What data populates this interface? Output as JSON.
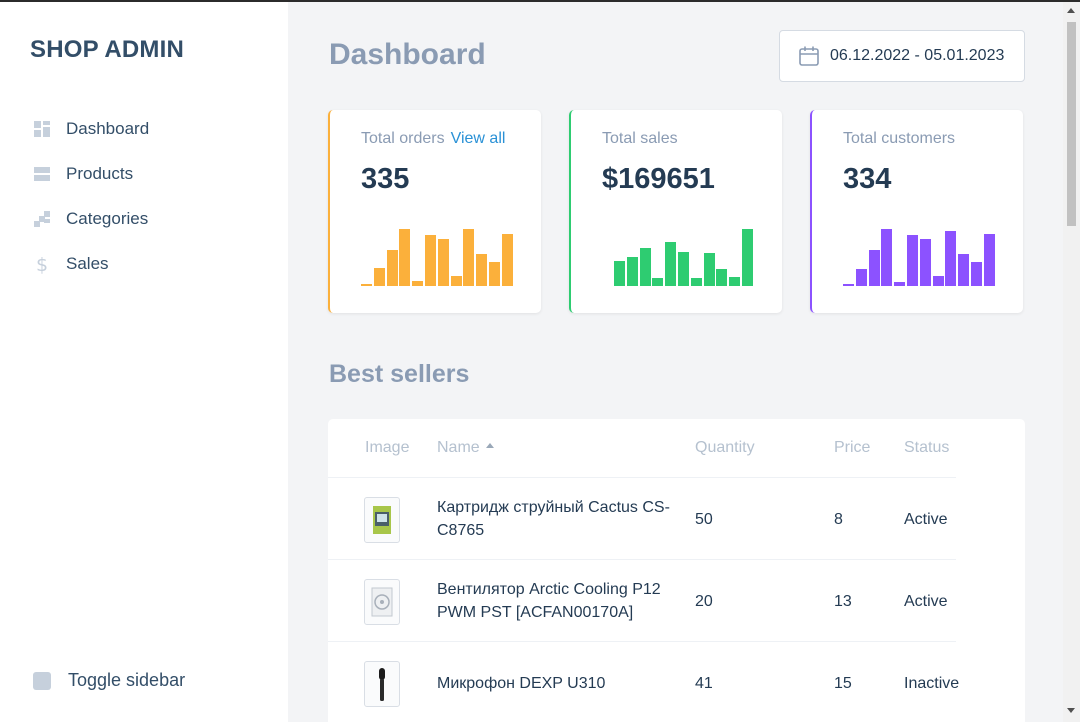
{
  "app": {
    "brand": "SHOP ADMIN"
  },
  "sidebar": {
    "items": [
      {
        "label": "Dashboard",
        "icon": "dashboard-icon"
      },
      {
        "label": "Products",
        "icon": "products-icon"
      },
      {
        "label": "Categories",
        "icon": "categories-icon"
      },
      {
        "label": "Sales",
        "icon": "dollar-icon"
      }
    ],
    "toggle_label": "Toggle sidebar"
  },
  "header": {
    "title": "Dashboard",
    "date_range": "06.12.2022 - 05.01.2023"
  },
  "stats": [
    {
      "label": "Total orders",
      "link": "View all",
      "value": "335",
      "color": "#fbb03b",
      "bars": [
        0.04,
        0.32,
        0.64,
        1.0,
        0.08,
        0.9,
        0.82,
        0.18,
        1.0,
        0.56,
        0.42,
        0.92
      ]
    },
    {
      "label": "Total sales",
      "link": "",
      "value": "$169651",
      "color": "#2ecc71",
      "bars": [
        0.44,
        0.5,
        0.66,
        0.14,
        0.78,
        0.6,
        0.14,
        0.58,
        0.3,
        0.16,
        1.0
      ]
    },
    {
      "label": "Total customers",
      "link": "",
      "value": "334",
      "color": "#8c52ff",
      "bars": [
        0.02,
        0.3,
        0.64,
        1.0,
        0.07,
        0.9,
        0.82,
        0.17,
        0.96,
        0.56,
        0.42,
        0.92
      ]
    }
  ],
  "best_sellers": {
    "title": "Best sellers",
    "columns": [
      "Image",
      "Name",
      "Quantity",
      "Price",
      "Status"
    ],
    "rows": [
      {
        "name": "Картридж струйный Cactus CS-C8765",
        "quantity": "50",
        "price": "8",
        "status": "Active"
      },
      {
        "name": "Вентилятор Arctic Cooling P12 PWM PST [ACFAN00170A]",
        "quantity": "20",
        "price": "13",
        "status": "Active"
      },
      {
        "name": "Микрофон DEXP U310",
        "quantity": "41",
        "price": "15",
        "status": "Inactive"
      }
    ]
  }
}
